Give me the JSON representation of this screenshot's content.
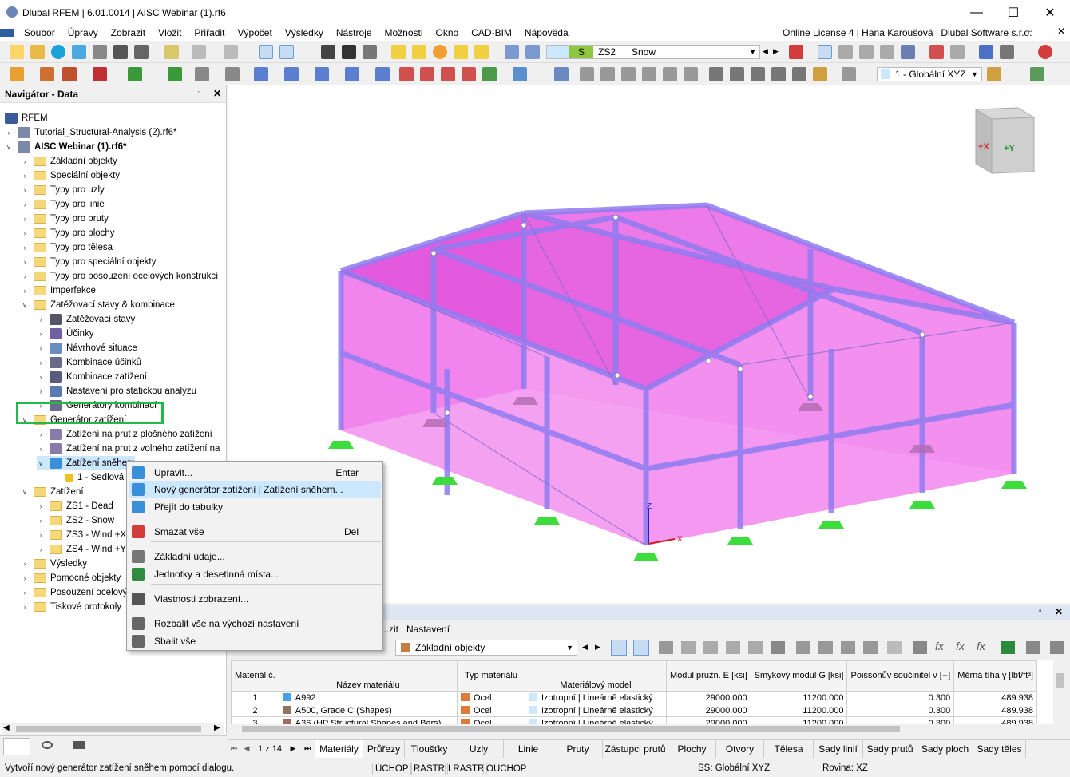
{
  "window": {
    "title": "Dlubal RFEM | 6.01.0014 | AISC Webinar (1).rf6"
  },
  "menu": [
    "Soubor",
    "Úpravy",
    "Zobrazit",
    "Vložit",
    "Přiřadit",
    "Výpočet",
    "Výsledky",
    "Nástroje",
    "Možnosti",
    "Okno",
    "CAD-BIM",
    "Nápověda"
  ],
  "license": "Online License 4 | Hana Karoušová | Dlubal Software s.r.o.",
  "loadcase": {
    "badge": "S",
    "id": "ZS2",
    "name": "Snow"
  },
  "coord_system": "1 - Globální XYZ",
  "navigator": {
    "title": "Navigátor - Data",
    "tree": [
      {
        "label": "RFEM",
        "level": 0
      },
      {
        "label": "Tutorial_Structural-Analysis (2).rf6*",
        "level": 1
      },
      {
        "label": "AISC Webinar (1).rf6*",
        "level": 1,
        "bold": true
      },
      {
        "label": "Základní objekty",
        "level": 2
      },
      {
        "label": "Speciální objekty",
        "level": 2
      },
      {
        "label": "Typy pro uzly",
        "level": 2
      },
      {
        "label": "Typy pro linie",
        "level": 2
      },
      {
        "label": "Typy pro pruty",
        "level": 2
      },
      {
        "label": "Typy pro plochy",
        "level": 2
      },
      {
        "label": "Typy pro tělesa",
        "level": 2
      },
      {
        "label": "Typy pro speciální objekty",
        "level": 2
      },
      {
        "label": "Typy pro posouzení ocelových konstrukcí",
        "level": 2
      },
      {
        "label": "Imperfekce",
        "level": 2
      },
      {
        "label": "Zatěžovací stavy & kombinace",
        "level": 2
      },
      {
        "label": "Zatěžovací stavy",
        "level": 3
      },
      {
        "label": "Účinky",
        "level": 3
      },
      {
        "label": "Návrhové situace",
        "level": 3
      },
      {
        "label": "Kombinace účinků",
        "level": 3
      },
      {
        "label": "Kombinace zatížení",
        "level": 3
      },
      {
        "label": "Nastavení pro statickou analýzu",
        "level": 3
      },
      {
        "label": "Generátory kombinací",
        "level": 3
      },
      {
        "label": "Generátor zatížení",
        "level": 2
      },
      {
        "label": "Zatížení na prut z plošného zatížení",
        "level": 3
      },
      {
        "label": "Zatížení na prut z volného zatížení na",
        "level": 3
      },
      {
        "label": "Zatížení sněhem",
        "level": 3
      },
      {
        "label": "1 - Sedlová",
        "level": 4
      },
      {
        "label": "Zatížení",
        "level": 2
      },
      {
        "label": "ZS1 - Dead",
        "level": 3
      },
      {
        "label": "ZS2 - Snow",
        "level": 3
      },
      {
        "label": "ZS3 - Wind +X",
        "level": 3
      },
      {
        "label": "ZS4 - Wind +Y",
        "level": 3
      },
      {
        "label": "Výsledky",
        "level": 2
      },
      {
        "label": "Pomocné objekty",
        "level": 2
      },
      {
        "label": "Posouzení ocelových",
        "level": 2
      },
      {
        "label": "Tiskové protokoly",
        "level": 2
      }
    ]
  },
  "context_menu": [
    {
      "label": "Upravit...",
      "shortcut": "Enter"
    },
    {
      "label": "Nový generátor zatížení | Zatížení sněhem...",
      "shortcut": ""
    },
    {
      "label": "Přejít do tabulky",
      "shortcut": ""
    },
    {
      "label": "Smazat vše",
      "shortcut": "Del"
    },
    {
      "label": "Základní údaje...",
      "shortcut": ""
    },
    {
      "label": "Jednotky a desetinná místa...",
      "shortcut": ""
    },
    {
      "label": "Vlastnosti zobrazení...",
      "shortcut": ""
    },
    {
      "label": "Rozbalit vše na výchozí nastavení",
      "shortcut": ""
    },
    {
      "label": "Sbalit vše",
      "shortcut": ""
    }
  ],
  "table_panel": {
    "menu": [
      "...zit",
      "Nastavení"
    ],
    "filter": "Základní objekty",
    "headers": [
      "Materiál č.",
      "Název materiálu",
      "Typ materiálu",
      "Materiálový model",
      "Modul pružn. E [ksi]",
      "Smykový modul G [ksi]",
      "Poissonův součinitel ν [--]",
      "Měrná tíha γ [lbf/ft³]"
    ],
    "rows": [
      {
        "no": "1",
        "name": "A992",
        "color": "#4a9ee8",
        "type": "Ocel",
        "model": "Izotropní | Lineárně elastický",
        "E": "29000.000",
        "G": "11200.000",
        "nu": "0.300",
        "gamma": "489.938"
      },
      {
        "no": "2",
        "name": "A500, Grade C (Shapes)",
        "color": "#8d7361",
        "type": "Ocel",
        "model": "Izotropní | Lineárně elastický",
        "E": "29000.000",
        "G": "11200.000",
        "nu": "0.300",
        "gamma": "489.938"
      },
      {
        "no": "3",
        "name": "A36 (HP Structural Shapes and Bars)",
        "color": "#a06a6a",
        "type": "Ocel",
        "model": "Izotropní | Lineárně elastický",
        "E": "29000.000",
        "G": "11200.000",
        "nu": "0.300",
        "gamma": "489.938"
      }
    ]
  },
  "pager": "1 z 14",
  "tabs": [
    "Materiály",
    "Průřezy",
    "Tloušťky",
    "Uzly",
    "Linie",
    "Pruty",
    "Zástupci prutů",
    "Plochy",
    "Otvory",
    "Tělesa",
    "Sady linií",
    "Sady prutů",
    "Sady ploch",
    "Sady těles"
  ],
  "status": {
    "message": "Vytvoří nový generátor zatížení sněhem pomocí dialogu.",
    "toggles": [
      "ÚCHOP",
      "RASTR",
      "LRASTR",
      "OUCHOP"
    ],
    "cs": "SS: Globální XYZ",
    "plane": "Rovina: XZ"
  },
  "cube": {
    "x": "+X",
    "y": "+Y"
  },
  "axes": {
    "x": "X",
    "z": "Z"
  },
  "colors": {
    "surface": "#f04de8",
    "member": "#8f7cf0",
    "support": "#3bdc3b",
    "highlight_box": "#22b94a",
    "selected": "#cce8ff"
  }
}
